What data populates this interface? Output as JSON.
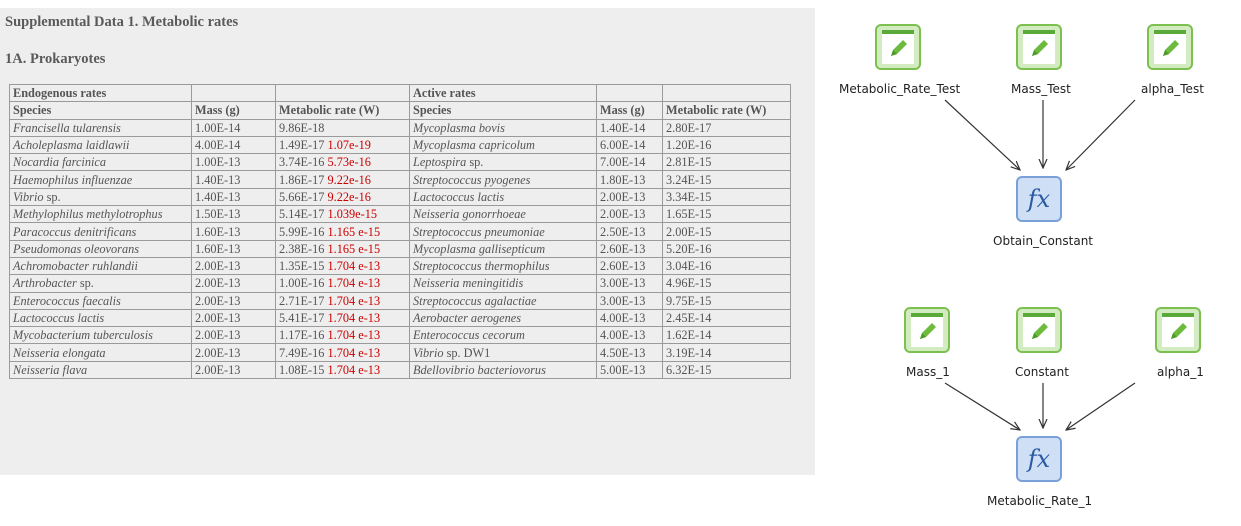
{
  "document": {
    "title": "Supplemental Data 1. Metabolic rates",
    "section": "1A. Prokaryotes",
    "group_headers": [
      "Endogenous rates",
      "Active rates"
    ],
    "columns": [
      "Species",
      "Mass (g)",
      "Metabolic rate (W)",
      "Species",
      "Mass (g)",
      "Metabolic rate (W)"
    ],
    "rows": [
      {
        "sp1": "Francisella tularensis",
        "m1": "1.00E-14",
        "r1": "9.86E-18",
        "r1b": "",
        "sp2": "Mycoplasma bovis",
        "m2": "1.40E-14",
        "r2": "2.80E-17"
      },
      {
        "sp1": "Acholeplasma laidlawii",
        "m1": "4.00E-14",
        "r1": "1.49E-17",
        "r1b": "1.07e-19",
        "sp2": "Mycoplasma capricolum",
        "m2": "6.00E-14",
        "r2": "1.20E-16"
      },
      {
        "sp1": "Nocardia farcinica",
        "m1": "1.00E-13",
        "r1": "3.74E-16",
        "r1b": "5.73e-16",
        "sp2": "Leptospira sp.",
        "m2": "7.00E-14",
        "r2": "2.81E-15"
      },
      {
        "sp1": "Haemophilus influenzae",
        "m1": "1.40E-13",
        "r1": "1.86E-17",
        "r1b": "9.22e-16",
        "sp2": "Streptococcus pyogenes",
        "m2": "1.80E-13",
        "r2": "3.24E-15"
      },
      {
        "sp1": "Vibrio sp.",
        "m1": "1.40E-13",
        "r1": "5.66E-17",
        "r1b": "9.22e-16",
        "sp2": "Lactococcus lactis",
        "m2": "2.00E-13",
        "r2": "3.34E-15"
      },
      {
        "sp1": "Methylophilus methylotrophus",
        "m1": "1.50E-13",
        "r1": "5.14E-17",
        "r1b": "1.039e-15",
        "sp2": "Neisseria gonorrhoeae",
        "m2": "2.00E-13",
        "r2": "1.65E-15"
      },
      {
        "sp1": "Paracoccus denitrificans",
        "m1": "1.60E-13",
        "r1": "5.99E-16",
        "r1b": "1.165 e-15",
        "sp2": "Streptococcus pneumoniae",
        "m2": "2.50E-13",
        "r2": "2.00E-15"
      },
      {
        "sp1": "Pseudomonas oleovorans",
        "m1": "1.60E-13",
        "r1": "2.38E-16",
        "r1b": "1.165 e-15",
        "sp2": "Mycoplasma gallisepticum",
        "m2": "2.60E-13",
        "r2": "5.20E-16"
      },
      {
        "sp1": "Achromobacter ruhlandii",
        "m1": "2.00E-13",
        "r1": "1.35E-15",
        "r1b": "1.704 e-13",
        "sp2": "Streptococcus thermophilus",
        "m2": "2.60E-13",
        "r2": "3.04E-16"
      },
      {
        "sp1": "Arthrobacter sp.",
        "m1": "2.00E-13",
        "r1": "1.00E-16",
        "r1b": "1.704 e-13",
        "sp2": "Neisseria meningitidis",
        "m2": "3.00E-13",
        "r2": "4.96E-15"
      },
      {
        "sp1": "Enterococcus faecalis",
        "m1": "2.00E-13",
        "r1": "2.71E-17",
        "r1b": "1.704 e-13",
        "sp2": "Streptococcus agalactiae",
        "m2": "3.00E-13",
        "r2": "9.75E-15"
      },
      {
        "sp1": "Lactococcus lactis",
        "m1": "2.00E-13",
        "r1": "5.41E-17",
        "r1b": "1.704 e-13",
        "sp2": "Aerobacter aerogenes",
        "m2": "4.00E-13",
        "r2": "2.45E-14"
      },
      {
        "sp1": "Mycobacterium tuberculosis",
        "m1": "2.00E-13",
        "r1": "1.17E-16",
        "r1b": "1.704 e-13",
        "sp2": "Enterococcus cecorum",
        "m2": "4.00E-13",
        "r2": "1.62E-14"
      },
      {
        "sp1": "Neisseria elongata",
        "m1": "2.00E-13",
        "r1": "7.49E-16",
        "r1b": "1.704 e-13",
        "sp2": "Vibrio sp. DW1",
        "m2": "4.50E-13",
        "r2": "3.19E-14"
      },
      {
        "sp1": "Neisseria flava",
        "m1": "2.00E-13",
        "r1": "1.08E-15",
        "r1b": "1.704 e-13",
        "sp2": "Bdellovibrio bacteriovorus",
        "m2": "5.00E-13",
        "r2": "6.32E-15"
      }
    ]
  },
  "workflow": {
    "nodes": {
      "metabolic_rate_test": {
        "label": "Metabolic_Rate_Test",
        "icon": "pencil-edit-icon"
      },
      "mass_test": {
        "label": "Mass_Test",
        "icon": "pencil-edit-icon"
      },
      "alpha_test": {
        "label": "alpha_Test",
        "icon": "pencil-edit-icon"
      },
      "obtain_constant": {
        "label": "Obtain_Constant",
        "icon": "function-icon",
        "glyph": "fx"
      },
      "mass_1": {
        "label": "Mass_1",
        "icon": "pencil-edit-icon"
      },
      "constant": {
        "label": "Constant",
        "icon": "pencil-edit-icon"
      },
      "alpha_1": {
        "label": "alpha_1",
        "icon": "pencil-edit-icon"
      },
      "metabolic_rate_1": {
        "label": "Metabolic_Rate_1",
        "icon": "function-icon",
        "glyph": "fx"
      }
    },
    "colors": {
      "variable_border": "#7cc050",
      "function_border": "#7aa0d8"
    }
  }
}
